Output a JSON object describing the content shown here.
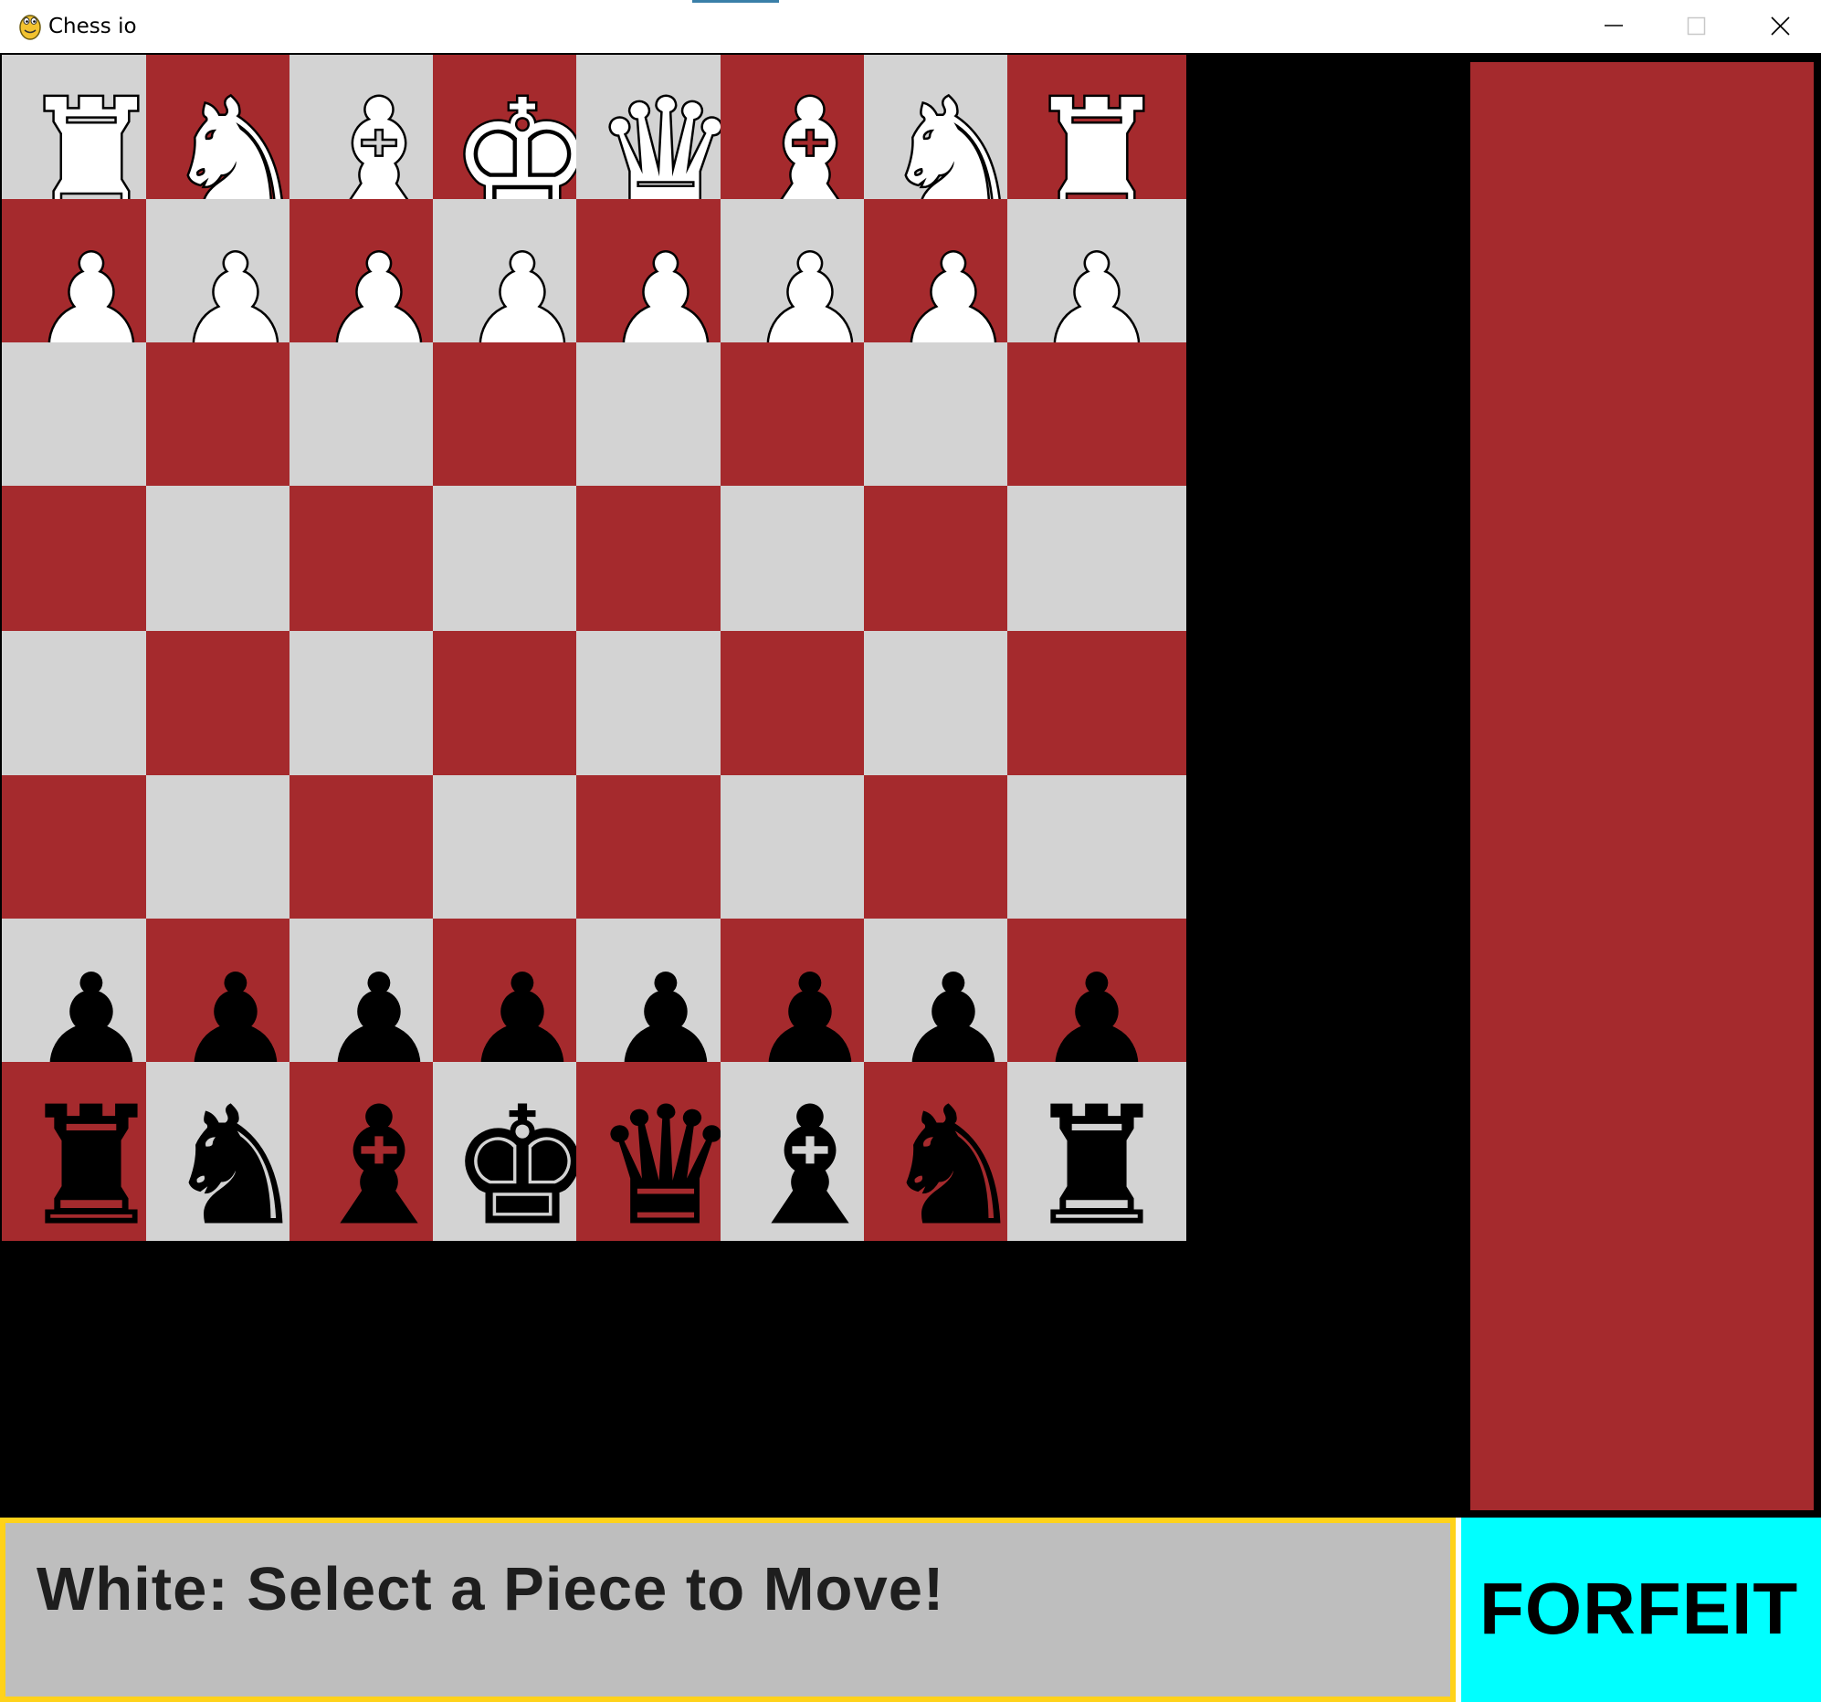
{
  "window": {
    "title": "Chess io",
    "controls": [
      "minimize-icon",
      "maximize-icon",
      "close-icon"
    ]
  },
  "colors": {
    "light_square": "#d3d3d3",
    "dark_square": "#a52a2d",
    "grid_line": "#000000",
    "sidebar": "#a52a2d",
    "status_background": "#bebebe",
    "status_border": "#ffd21a",
    "forfeit_background": "#00ffff",
    "white_piece": "#ffffff",
    "black_piece": "#000000"
  },
  "board": {
    "first_square_color": "light",
    "rows": [
      [
        "white-rook",
        "white-knight",
        "white-bishop",
        "white-king",
        "white-queen",
        "white-bishop",
        "white-knight",
        "white-rook"
      ],
      [
        "white-pawn",
        "white-pawn",
        "white-pawn",
        "white-pawn",
        "white-pawn",
        "white-pawn",
        "white-pawn",
        "white-pawn"
      ],
      [
        null,
        null,
        null,
        null,
        null,
        null,
        null,
        null
      ],
      [
        null,
        null,
        null,
        null,
        null,
        null,
        null,
        null
      ],
      [
        null,
        null,
        null,
        null,
        null,
        null,
        null,
        null
      ],
      [
        null,
        null,
        null,
        null,
        null,
        null,
        null,
        null
      ],
      [
        "black-pawn",
        "black-pawn",
        "black-pawn",
        "black-pawn",
        "black-pawn",
        "black-pawn",
        "black-pawn",
        "black-pawn"
      ],
      [
        "black-rook",
        "black-knight",
        "black-bishop",
        "black-king",
        "black-queen",
        "black-bishop",
        "black-knight",
        "black-rook"
      ]
    ]
  },
  "status": {
    "message": "White: Select a Piece to Move!"
  },
  "forfeit": {
    "label": "FORFEIT"
  }
}
